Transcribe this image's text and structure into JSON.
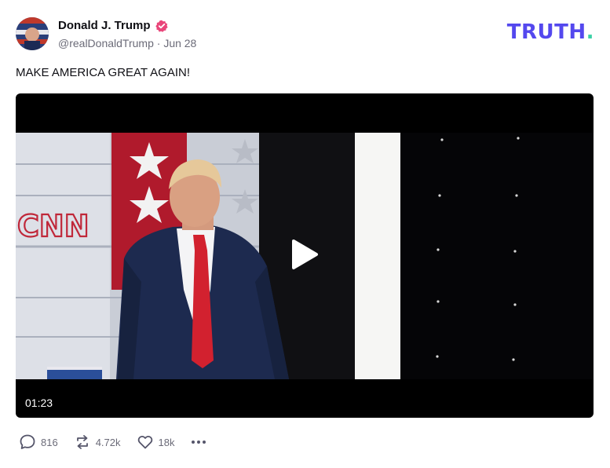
{
  "post": {
    "author": {
      "display_name": "Donald J. Trump",
      "handle": "@realDonaldTrump",
      "date": "Jun 28",
      "verified_color": "#e9467a"
    },
    "text": "MAKE AMERICA GREAT AGAIN!",
    "video": {
      "duration": "01:23",
      "overlay_text": "CNN"
    },
    "actions": {
      "replies": "816",
      "retruths": "4.72k",
      "likes": "18k"
    }
  },
  "brand": {
    "logo_text": "TRUTH",
    "logo_dot": ".",
    "logo_color": "#5448ee",
    "logo_dot_color": "#3bd1a6"
  }
}
